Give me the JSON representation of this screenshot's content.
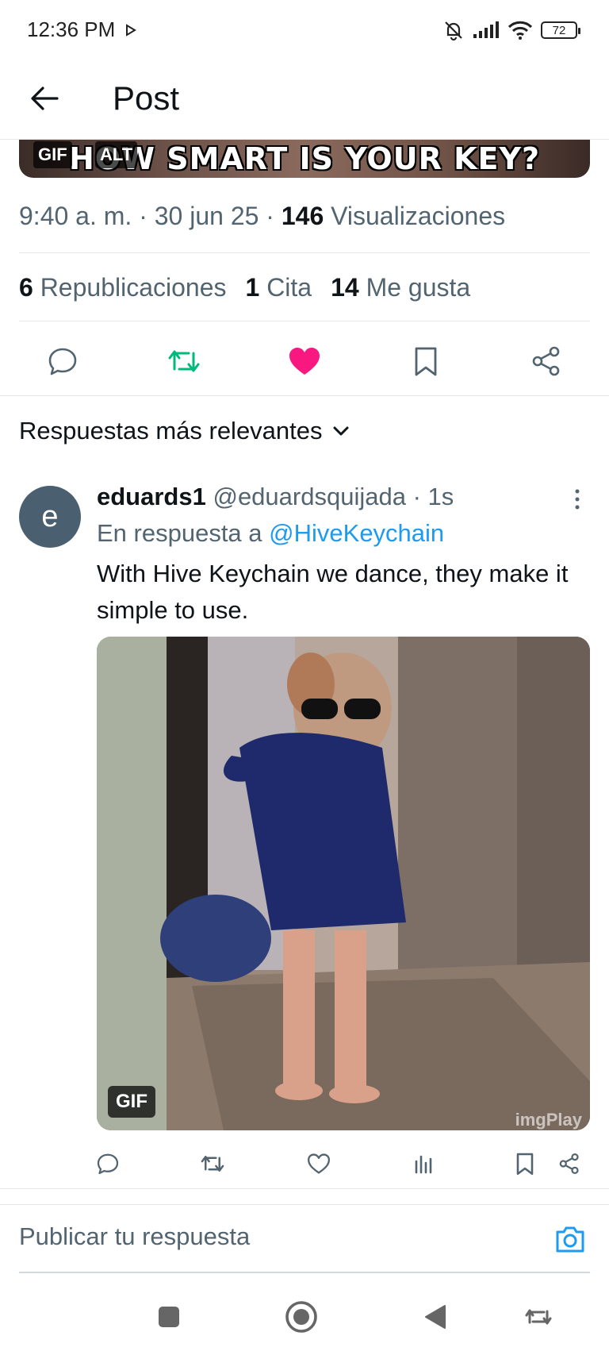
{
  "status_bar": {
    "time": "12:36 PM",
    "battery": "72"
  },
  "header": {
    "title": "Post"
  },
  "media": {
    "caption": "HOW SMART IS YOUR KEY?",
    "gif_badge": "GIF",
    "alt_badge": "ALT"
  },
  "meta": {
    "time": "9:40 a. m.",
    "date": "30 jun 25",
    "views_count": "146",
    "views_label": "Visualizaciones"
  },
  "stats": {
    "reposts_count": "6",
    "reposts_label": "Republicaciones",
    "quotes_count": "1",
    "quotes_label": "Cita",
    "likes_count": "14",
    "likes_label": "Me gusta"
  },
  "colors": {
    "repost_active": "#00ba7c",
    "like_active": "#f91880",
    "link": "#1d9bf0",
    "camera": "#1d9bf0"
  },
  "replies": {
    "sort_label": "Respuestas más relevantes"
  },
  "reply": {
    "avatar_letter": "e",
    "name": "eduards1",
    "handle": "@eduardsquijada",
    "time": "1s",
    "in_reply_to_prefix": "En respuesta a",
    "in_reply_to_handle": "@HiveKeychain",
    "text": "With Hive Keychain we dance, they make it simple to use.",
    "gif_badge": "GIF",
    "watermark": "imgPlay"
  },
  "composer": {
    "placeholder": "Publicar tu respuesta"
  }
}
